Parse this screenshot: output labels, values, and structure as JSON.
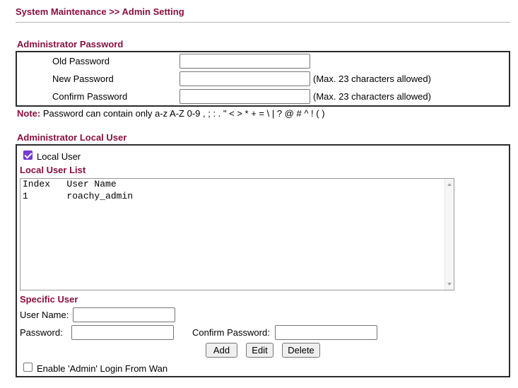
{
  "header": {
    "breadcrumb": "System Maintenance >> Admin Setting"
  },
  "admin_password": {
    "section_title": "Administrator Password",
    "old_label": "Old Password",
    "new_label": "New Password",
    "confirm_label": "Confirm Password",
    "old_value": "",
    "new_value": "",
    "confirm_value": "",
    "max_hint": "(Max. 23 characters allowed)",
    "note_label": "Note:",
    "note_text": "Password can contain only a-z A-Z 0-9 , ; : . \" < > * + = \\ | ? @ # ^ ! ( )"
  },
  "local_user": {
    "section_title": "Administrator Local User",
    "local_user_label": "Local User",
    "local_user_checked": true,
    "list_title": "Local User List",
    "list_header": "Index   User Name",
    "list_rows": [
      "1       roachy_admin"
    ],
    "specific_title": "Specific User",
    "username_label": "User Name:",
    "password_label": "Password:",
    "confirm_label": "Confirm Password:",
    "username_value": "",
    "password_value": "",
    "confirm_value": "",
    "add_label": "Add",
    "edit_label": "Edit",
    "delete_label": "Delete",
    "wan_label": "Enable 'Admin' Login From Wan",
    "wan_checked": false
  },
  "colors": {
    "accent": "#8a0f3d",
    "checkbox": "#7a3bd6"
  }
}
